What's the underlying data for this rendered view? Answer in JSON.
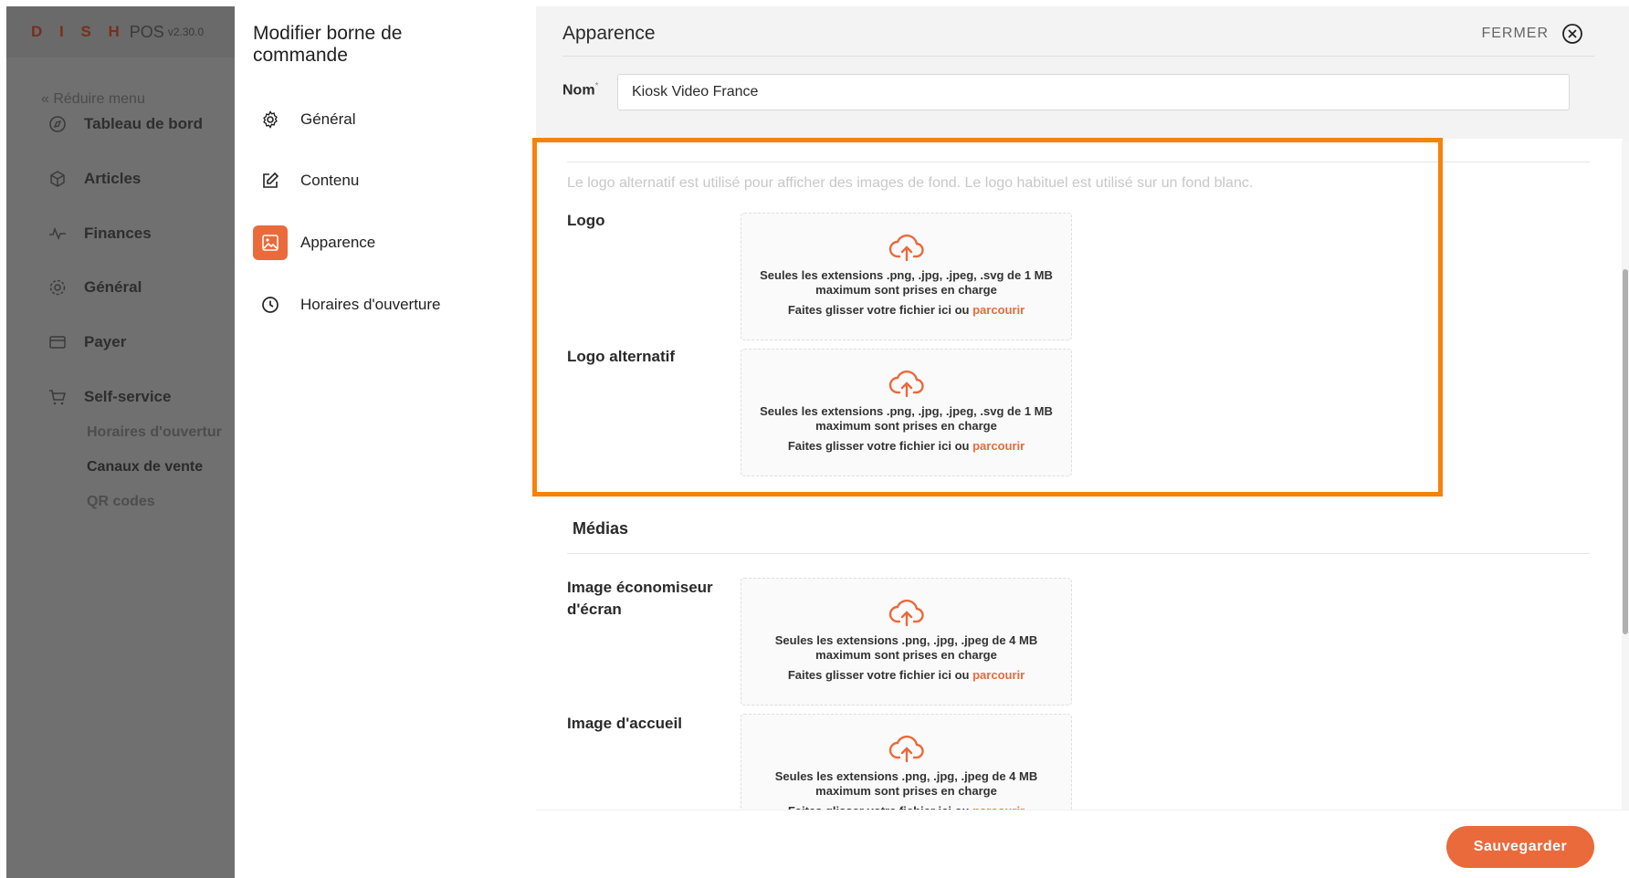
{
  "app": {
    "brand": "D I S H",
    "product": "POS",
    "version": "v2.30.0",
    "collapse_label": "« Réduire menu"
  },
  "sidebar": {
    "items": [
      {
        "label": "Tableau de bord",
        "icon": "dashboard-icon"
      },
      {
        "label": "Articles",
        "icon": "box-icon"
      },
      {
        "label": "Finances",
        "icon": "pulse-icon"
      },
      {
        "label": "Général",
        "icon": "gear-icon"
      },
      {
        "label": "Payer",
        "icon": "card-icon"
      },
      {
        "label": "Self-service",
        "icon": "cart-icon"
      }
    ],
    "sub_items": [
      {
        "label": "Horaires d'ouvertur"
      },
      {
        "label": "Canaux de vente"
      },
      {
        "label": "QR codes"
      }
    ]
  },
  "panel": {
    "title": "Modifier borne de commande",
    "items": [
      {
        "label": "Général",
        "icon": "gear-icon"
      },
      {
        "label": "Contenu",
        "icon": "edit-icon"
      },
      {
        "label": "Apparence",
        "icon": "image-icon"
      },
      {
        "label": "Horaires d'ouverture",
        "icon": "clock-icon"
      }
    ]
  },
  "main": {
    "title": "Apparence",
    "close_label": "FERMER",
    "name_label": "Nom",
    "name_required": "*",
    "name_value": "Kiosk Video France",
    "hint": "Le logo alternatif est utilisé pour afficher des images de fond. Le logo habituel est utilisé sur un fond blanc.",
    "logo_label": "Logo",
    "alt_logo_label": "Logo alternatif",
    "media_title": "Médias",
    "screensaver_label": "Image économiseur d'écran",
    "welcome_label": "Image d'accueil",
    "dropzone_svg_text": "Seules les extensions .png, .jpg, .jpeg, .svg de 1 MB maximum sont prises en charge",
    "dropzone_jpg_text": "Seules les extensions .png, .jpg, .jpeg de 4 MB maximum sont prises en charge",
    "drag_text": "Faites glisser votre fichier ici ou ",
    "browse_text": "parcourir",
    "save_label": "Sauvegarder"
  },
  "colors": {
    "accent": "#ea6a3c",
    "highlight": "#f7820a"
  }
}
